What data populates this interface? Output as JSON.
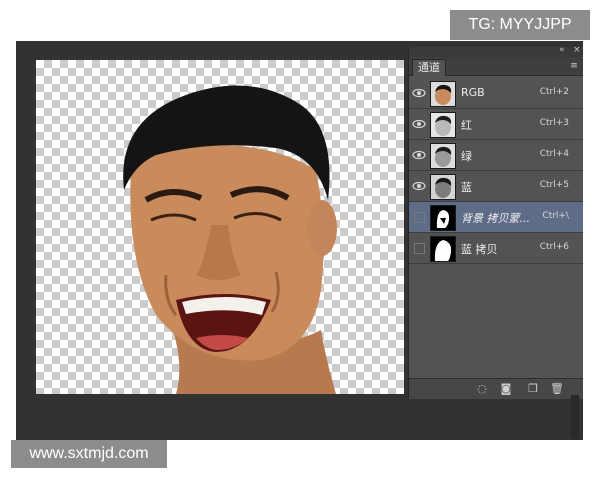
{
  "watermarks": {
    "tg": "TG: MYYJJPP",
    "site": "www.sxtmjd.com"
  },
  "panel": {
    "collapse_icon": "double-chevron-left-icon",
    "close_icon": "close-icon",
    "tab_label": "通道",
    "channels": [
      {
        "name": "RGB",
        "shortcut": "Ctrl+2",
        "visible": true,
        "thumb": "color"
      },
      {
        "name": "红",
        "shortcut": "Ctrl+3",
        "visible": true,
        "thumb": "gray-light"
      },
      {
        "name": "绿",
        "shortcut": "Ctrl+4",
        "visible": true,
        "thumb": "gray"
      },
      {
        "name": "蓝",
        "shortcut": "Ctrl+5",
        "visible": true,
        "thumb": "gray-dark"
      },
      {
        "name": "背景 拷贝蒙...",
        "shortcut": "Ctrl+\\",
        "visible": false,
        "thumb": "mask",
        "selected": true
      },
      {
        "name": "蓝 拷贝",
        "shortcut": "Ctrl+6",
        "visible": false,
        "thumb": "alpha"
      }
    ],
    "footer_icons": [
      "load-selection-icon",
      "save-selection-icon",
      "new-channel-icon",
      "trash-icon"
    ]
  },
  "colors": {
    "app_bg": "#323232",
    "panel_bg": "#535353",
    "selected_row": "#5f6c88"
  }
}
